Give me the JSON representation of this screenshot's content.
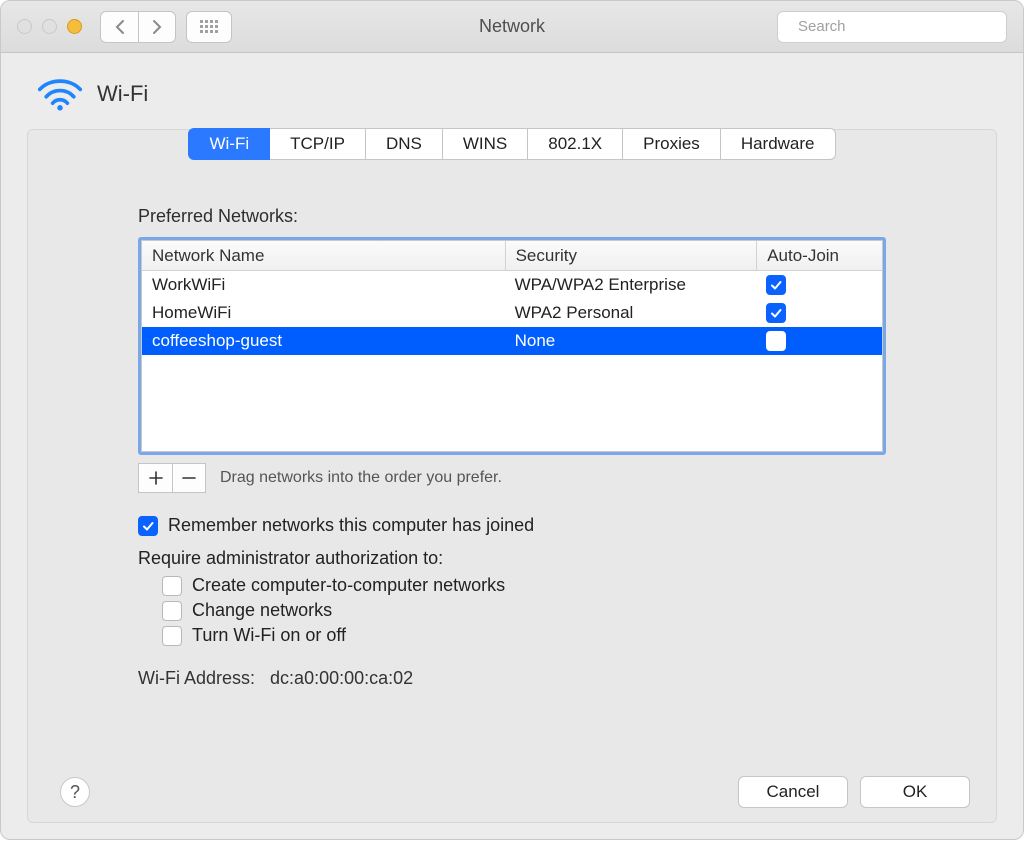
{
  "window": {
    "title": "Network"
  },
  "search": {
    "placeholder": "Search"
  },
  "header": {
    "title": "Wi-Fi"
  },
  "tabs": [
    {
      "label": "Wi-Fi",
      "active": true
    },
    {
      "label": "TCP/IP",
      "active": false
    },
    {
      "label": "DNS",
      "active": false
    },
    {
      "label": "WINS",
      "active": false
    },
    {
      "label": "802.1X",
      "active": false
    },
    {
      "label": "Proxies",
      "active": false
    },
    {
      "label": "Hardware",
      "active": false
    }
  ],
  "preferred_label": "Preferred Networks:",
  "columns": {
    "name": "Network Name",
    "security": "Security",
    "autojoin": "Auto-Join"
  },
  "networks": [
    {
      "name": "WorkWiFi",
      "security": "WPA/WPA2 Enterprise",
      "autojoin": true,
      "selected": false
    },
    {
      "name": "HomeWiFi",
      "security": "WPA2 Personal",
      "autojoin": true,
      "selected": false
    },
    {
      "name": "coffeeshop-guest",
      "security": "None",
      "autojoin": false,
      "selected": true
    }
  ],
  "drag_hint": "Drag networks into the order you prefer.",
  "remember": {
    "checked": true,
    "label": "Remember networks this computer has joined"
  },
  "admin_label": "Require administrator authorization to:",
  "admin_opts": [
    {
      "checked": false,
      "label": "Create computer-to-computer networks"
    },
    {
      "checked": false,
      "label": "Change networks"
    },
    {
      "checked": false,
      "label": "Turn Wi-Fi on or off"
    }
  ],
  "address": {
    "label": "Wi-Fi Address:",
    "value": "dc:a0:00:00:ca:02"
  },
  "buttons": {
    "cancel": "Cancel",
    "ok": "OK"
  }
}
